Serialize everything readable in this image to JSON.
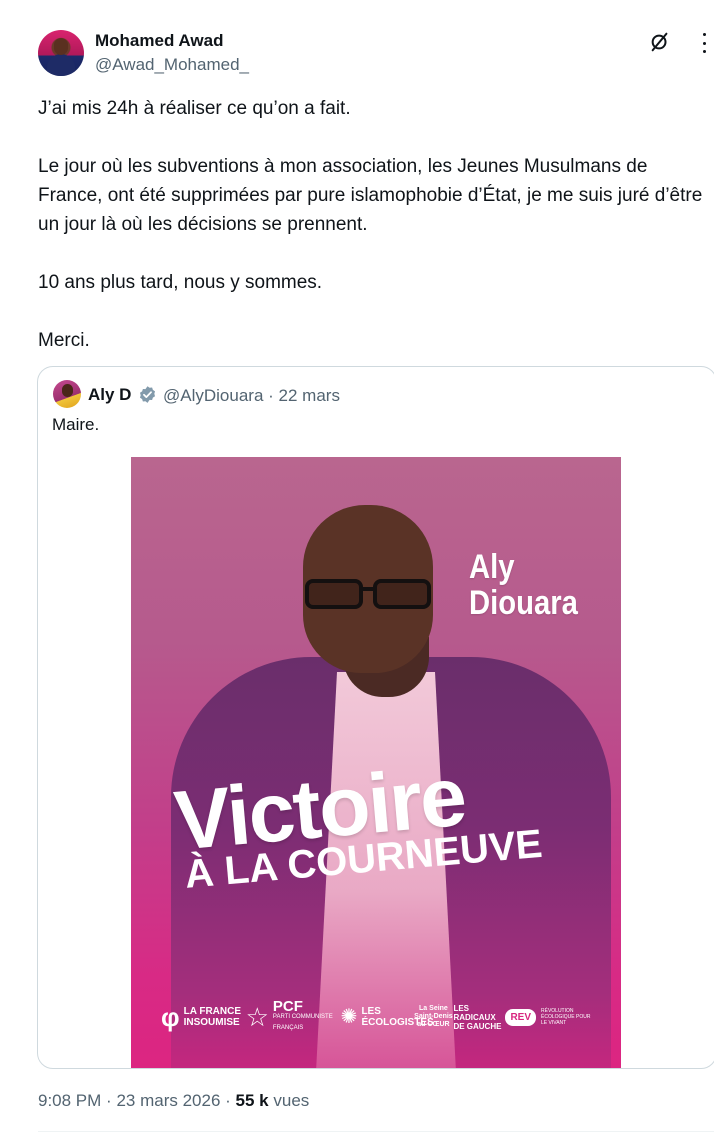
{
  "author": {
    "name": "Mohamed Awad",
    "handle": "@Awad_Mohamed_"
  },
  "icons": {
    "grok": "grok-icon",
    "more": "more-icon",
    "verified": "verified-badge-icon"
  },
  "tweet": {
    "paragraphs": [
      "J’ai mis 24h à réaliser ce qu’on a fait.",
      "Le jour où les subventions à mon association, les Jeunes Musulmans de France, ont été supprimées par pure islamophobie d’État, je me suis juré d’être un jour là où les décisions se prennent.",
      "10 ans plus tard, nous y sommes.",
      "Merci."
    ]
  },
  "quote": {
    "name": "Aly D",
    "handle": "@AlyDiouara",
    "separator": "·",
    "date": "22 mars",
    "text": "Maire.",
    "poster": {
      "name_line1": "Aly",
      "name_line2": "Diouara",
      "headline": "Victoire",
      "subheadline": "À LA COURNEUVE",
      "logos": [
        {
          "label": "LA FRANCE INSOUMISE"
        },
        {
          "label": "PCF",
          "sub": "PARTI COMMUNISTE FRANÇAIS"
        },
        {
          "label": "LES ÉCOLOGISTES"
        },
        {
          "label": "La Seine Saint-Denis au CŒUR"
        },
        {
          "label": "LES RADICAUX DE GAUCHE"
        },
        {
          "label": "REV",
          "sub": "RÉVOLUTION ÉCOLOGIQUE POUR LE VIVANT"
        }
      ]
    }
  },
  "footer": {
    "time": "9:08 PM",
    "date": "23 mars 2026",
    "views_count": "55 k",
    "views_label": "vues"
  },
  "colors": {
    "text": "#0f1419",
    "secondary": "#536471",
    "border": "#cfd9de",
    "verified": "#829aab",
    "poster_pink": "#d82a85"
  }
}
